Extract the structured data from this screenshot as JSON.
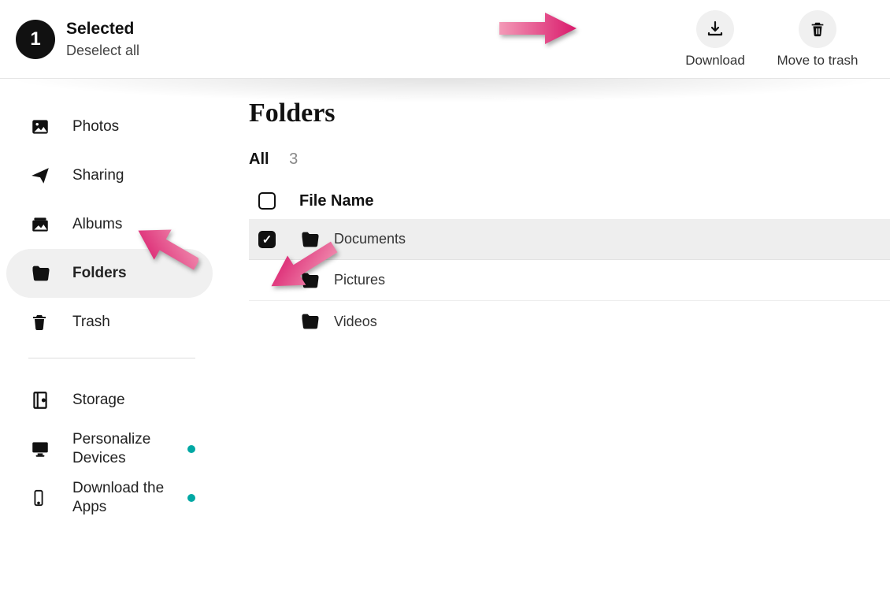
{
  "selection": {
    "count": "1",
    "title": "Selected",
    "deselect": "Deselect all"
  },
  "actions": {
    "download": "Download",
    "trash": "Move to trash"
  },
  "sidebar": {
    "photos": "Photos",
    "sharing": "Sharing",
    "albums": "Albums",
    "folders": "Folders",
    "trash": "Trash",
    "storage": "Storage",
    "personalize": "Personalize Devices",
    "download_apps": "Download the Apps"
  },
  "main": {
    "title": "Folders",
    "filter_all": "All",
    "filter_count": "3",
    "col_name": "File Name",
    "rows": [
      {
        "name": "Documents",
        "selected": true
      },
      {
        "name": "Pictures",
        "selected": false
      },
      {
        "name": "Videos",
        "selected": false
      }
    ]
  }
}
